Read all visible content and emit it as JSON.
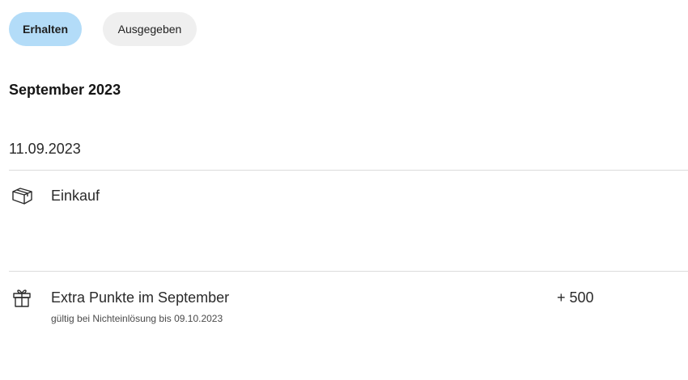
{
  "tabs": {
    "received": "Erhalten",
    "spent": "Ausgegeben"
  },
  "month": "September 2023",
  "date": "11.09.2023",
  "purchase": {
    "label": "Einkauf",
    "icon": "package-icon"
  },
  "bonus": {
    "label": "Extra Punkte im September",
    "sublabel": "gültig bei Nichteinlösung bis 09.10.2023",
    "points": "+ 500",
    "icon": "gift-icon"
  },
  "colors": {
    "active_tab": "#b3dcf8",
    "inactive_tab": "#efefef",
    "divider": "#dcdcdc"
  }
}
